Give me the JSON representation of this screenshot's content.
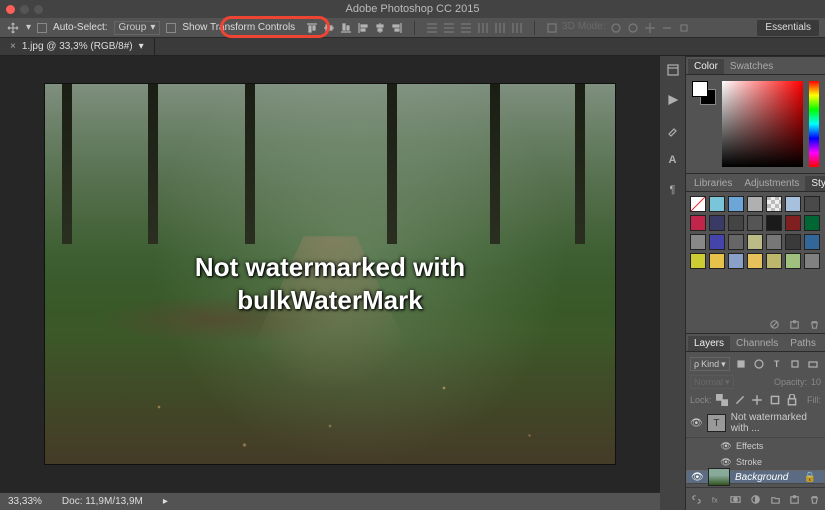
{
  "app": {
    "title": "Adobe Photoshop CC 2015"
  },
  "options": {
    "auto_select": "Auto-Select:",
    "group": "Group",
    "show_transform": "Show Transform Controls",
    "mode3d": "3D Mode:",
    "workspace": "Essentials"
  },
  "tab": {
    "label": "1.jpg @ 33,3% (RGB/8#)",
    "close": "×"
  },
  "canvas": {
    "watermark_line1": "Not watermarked with",
    "watermark_line2": "bulkWaterMark"
  },
  "status": {
    "zoom": "33,33%",
    "doc": "Doc: 11,9M/13,9M"
  },
  "panel_color": {
    "tab1": "Color",
    "tab2": "Swatches"
  },
  "panel_styles": {
    "tab1": "Libraries",
    "tab2": "Adjustments",
    "tab3": "Styles",
    "swatches": [
      "#ffffff00",
      "#7ac6d8",
      "#6ca6d9",
      "#b0b0b0",
      "#cpattern",
      "#a7c0dc",
      "#4a4a4a",
      "#c0254a",
      "#3a3a66",
      "#444",
      "#555",
      "#1a1a1a",
      "#7f1f1f",
      "#006633",
      "#888",
      "#44a",
      "#666",
      "#bb8",
      "#777",
      "#3a3a3a",
      "#369",
      "#cc3",
      "#e6c24a",
      "#8aa0c8",
      "#e6c05a",
      "#bdb76b",
      "#a0c080",
      "#808080"
    ]
  },
  "panel_layers": {
    "tab1": "Layers",
    "tab2": "Channels",
    "tab3": "Paths",
    "kind": "Kind",
    "blend": "Normal",
    "opacity_lbl": "Opacity:",
    "opacity_val": "10",
    "lock_lbl": "Lock:",
    "fill_lbl": "Fill:",
    "layer_text": "Not watermarked with ...",
    "effects": "Effects",
    "stroke": "Stroke",
    "background": "Background"
  },
  "sidegap_labels": [
    "A",
    "¶"
  ]
}
